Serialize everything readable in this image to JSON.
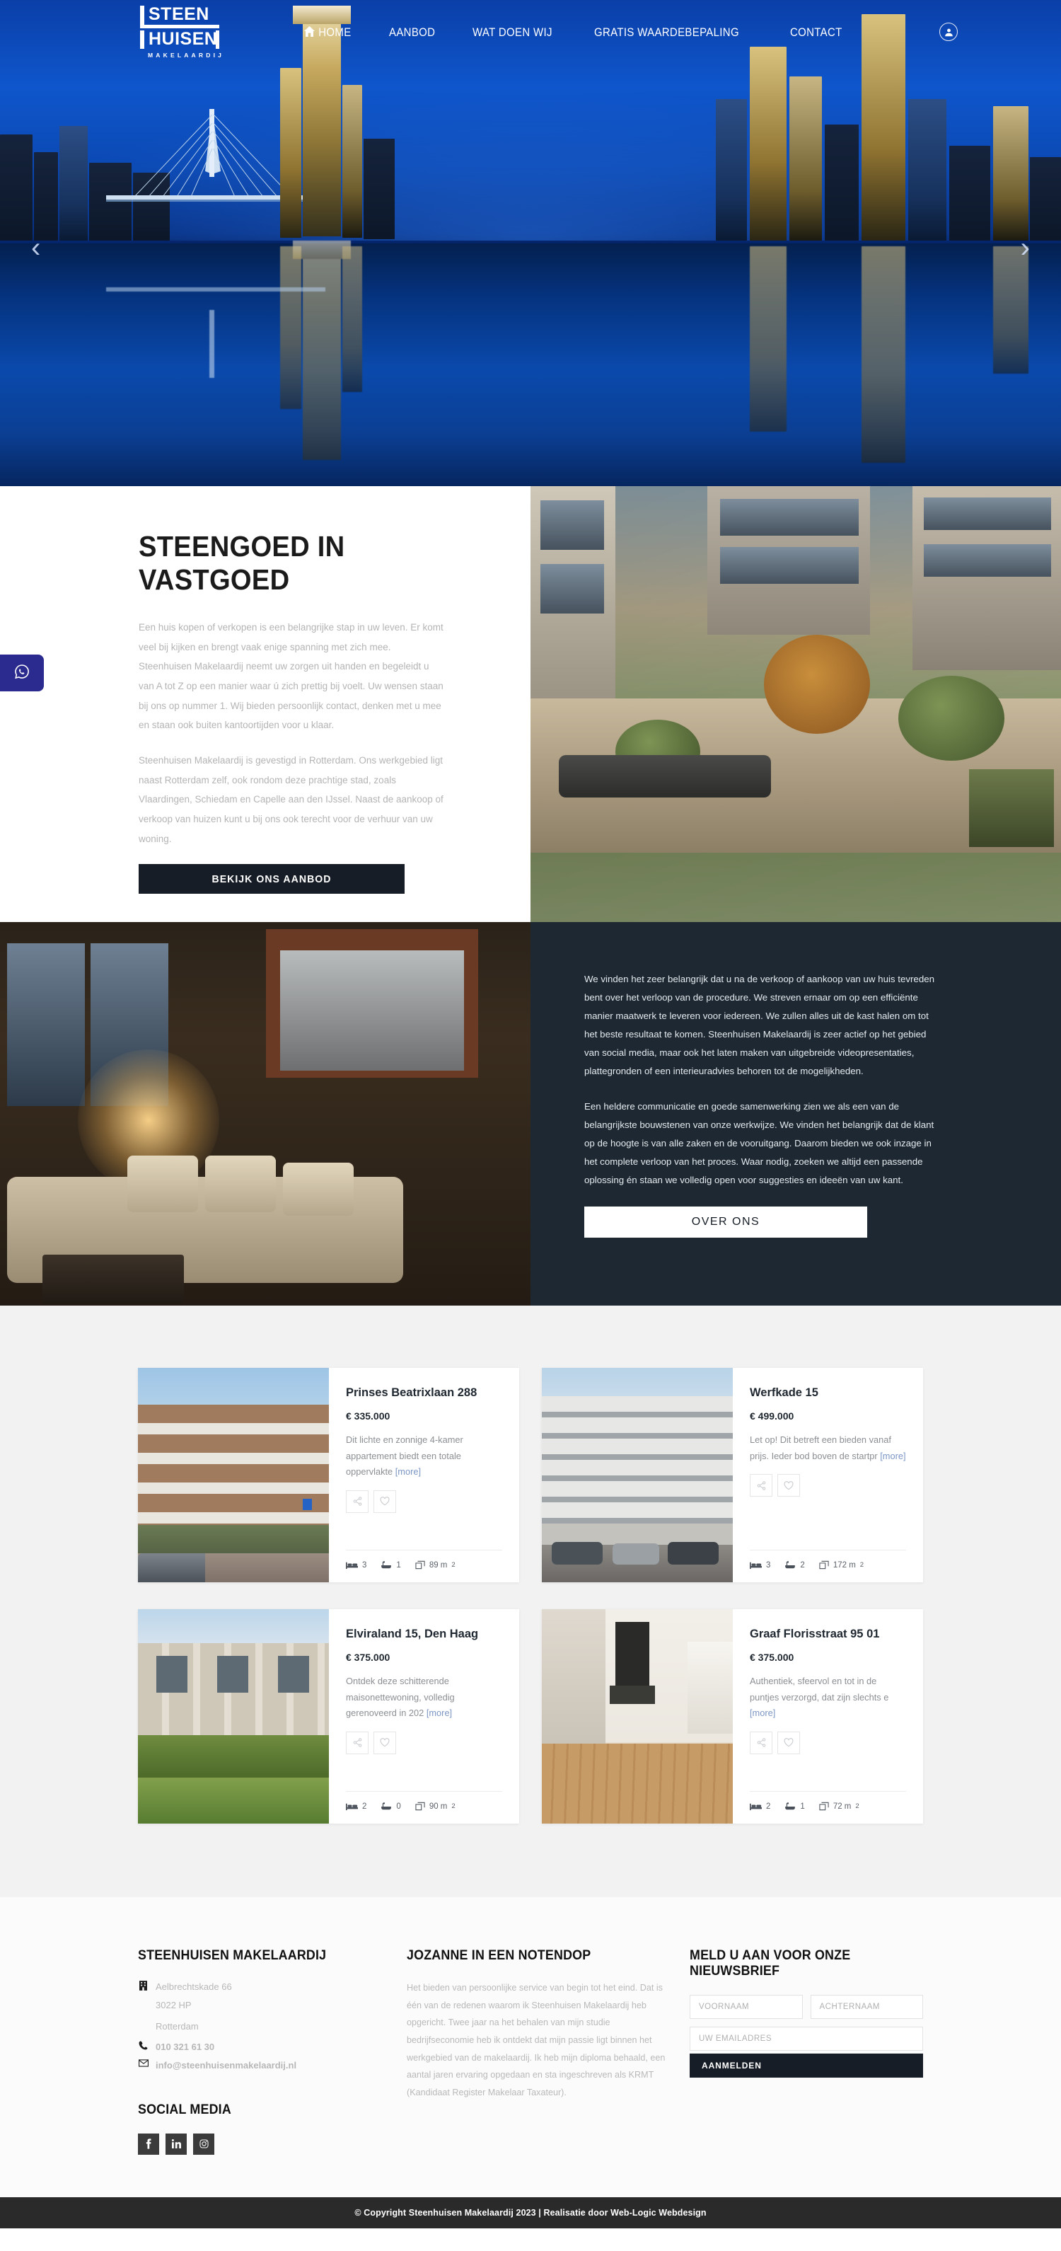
{
  "site": {
    "logo_line1": "STEEN",
    "logo_line2": "HUISEN",
    "logo_sub": "MAKELAARDIJ"
  },
  "nav": {
    "items": [
      {
        "label": "HOME",
        "icon": "home-icon"
      },
      {
        "label": "AANBOD",
        "icon": ""
      },
      {
        "label": "WAT DOEN WIJ",
        "icon": ""
      },
      {
        "label": "GRATIS WAARDEBEPALING",
        "icon": ""
      },
      {
        "label": "CONTACT",
        "icon": ""
      }
    ],
    "account_icon": "user-account-icon",
    "prev_arrow": "‹",
    "next_arrow": "›"
  },
  "float": {
    "whatsapp_icon": "whatsapp-icon"
  },
  "intro": {
    "heading": "STEENGOED IN VASTGOED",
    "paragraph1": "Een huis kopen of verkopen is een belangrijke stap in uw leven. Er komt veel bij kijken en brengt vaak enige spanning met zich mee. Steenhuisen Makelaardij neemt uw zorgen uit handen en begeleidt u van A tot Z op een manier waar ú zich prettig bij voelt. Uw wensen staan bij ons op nummer 1. Wij bieden persoonlijk contact, denken met u mee en staan ook buiten kantoortijden voor u klaar.",
    "paragraph2": "Steenhuisen Makelaardij is gevestigd in Rotterdam. Ons werkgebied ligt naast Rotterdam zelf, ook rondom deze prachtige stad, zoals Vlaardingen, Schiedam en Capelle aan den IJssel. Naast de aankoop of verkoop van huizen kunt u bij ons ook terecht voor de verhuur van uw woning.",
    "cta": "BEKIJK ONS AANBOD"
  },
  "about": {
    "paragraph1": "We vinden het zeer belangrijk dat u na de verkoop of aankoop van uw huis tevreden bent over het verloop van de procedure.  We streven ernaar om op een efficiënte manier maatwerk te leveren voor iedereen. We zullen alles uit de kast halen om tot het beste resultaat te komen. Steenhuisen Makelaardij is zeer actief op het gebied van social media, maar ook het laten maken van uitgebreide videopresentaties, plattegronden of een interieuradvies behoren tot de mogelijkheden.",
    "paragraph2": "Een heldere communicatie en goede samenwerking zien we als een van de belangrijkste bouwstenen van onze werkwijze. We vinden het belangrijk dat de klant op de hoogte is van alle zaken en de vooruitgang. Daarom bieden we ook inzage in het complete verloop van het proces. Waar nodig, zoeken we altijd een passende oplossing én staan we volledig open voor suggesties en ideeën van uw kant.",
    "cta": "OVER ONS"
  },
  "listings": {
    "more_label": "[more]",
    "share_icon": "share-icon",
    "favorite_icon": "heart-icon",
    "bed_icon": "bed-icon",
    "bath_icon": "bath-icon",
    "area_icon": "floorplan-icon",
    "items": [
      {
        "title": "Prinses Beatrixlaan 288",
        "price": "€ 335.000",
        "description": "Dit lichte en zonnige 4-kamer appartement biedt een totale oppervlakte",
        "beds": "3",
        "baths": "1",
        "area": "89 m",
        "area_sup": "2",
        "photo": "apartment-brick-facade"
      },
      {
        "title": "Werfkade 15",
        "price": "€ 499.000",
        "description": "Let op! Dit betreft een bieden vanaf prijs. Ieder bod boven de startpr",
        "beds": "3",
        "baths": "2",
        "area": "172 m",
        "area_sup": "2",
        "photo": "modern-white-building"
      },
      {
        "title": "Elviraland 15, Den Haag",
        "price": "€ 375.000",
        "description": "Ontdek deze schitterende maisonettewoning, volledig gerenoveerd in 202",
        "beds": "2",
        "baths": "0",
        "area": "90 m",
        "area_sup": "2",
        "photo": "terraced-house-hedge"
      },
      {
        "title": "Graaf Florisstraat 95 01",
        "price": "€ 375.000",
        "description": "Authentiek, sfeervol en tot in de puntjes verzorgd, dat zijn slechts e",
        "beds": "2",
        "baths": "1",
        "area": "72 m",
        "area_sup": "2",
        "photo": "empty-living-room"
      }
    ]
  },
  "footer": {
    "company": {
      "heading": "STEENHUISEN MAKELAARDIJ",
      "address_icon": "building-icon",
      "address_line1": "Aelbrechtskade 66",
      "address_line2": "3022 HP",
      "address_line3": "Rotterdam",
      "phone_icon": "phone-icon",
      "phone": "010 321 61 30",
      "mail_icon": "envelope-icon",
      "email": "info@steenhuisenmakelaardij.nl"
    },
    "social": {
      "heading": "SOCIAL MEDIA",
      "items": [
        {
          "name": "facebook-icon",
          "glyph": "f"
        },
        {
          "name": "linkedin-icon",
          "glyph": "in"
        },
        {
          "name": "instagram-icon",
          "glyph": "□"
        }
      ]
    },
    "bio": {
      "heading": "JOZANNE IN EEN NOTENDOP",
      "text": "Het bieden van persoonlijke service van begin tot het eind. Dat is één van de redenen waarom ik Steenhuisen Makelaardij heb opgericht. Twee jaar na het behalen van mijn studie bedrijfseconomie heb ik ontdekt dat mijn passie ligt binnen het werkgebied van de makelaardij. Ik heb mijn diploma behaald, een aantal jaren ervaring opgedaan en sta ingeschreven als KRMT (Kandidaat Register Makelaar Taxateur)."
    },
    "newsletter": {
      "heading": "MELD U AAN VOOR ONZE NIEUWSBRIEF",
      "firstname_placeholder": "VOORNAAM",
      "lastname_placeholder": "ACHTERNAAM",
      "email_placeholder": "UW EMAILADRES",
      "submit_label": "AANMELDEN"
    }
  },
  "copyright": {
    "text": "© Copyright Steenhuisen Makelaardij 2023 | Realisatie door Web-Logic Webdesign"
  },
  "colors": {
    "hero_blue": "#0b49b4",
    "dark": "#1e2832",
    "button_dark": "#161d26",
    "listing_bg": "#f2f2f2",
    "copy_bar": "#2a2a2a",
    "whatsapp": "#2b2b8f"
  }
}
